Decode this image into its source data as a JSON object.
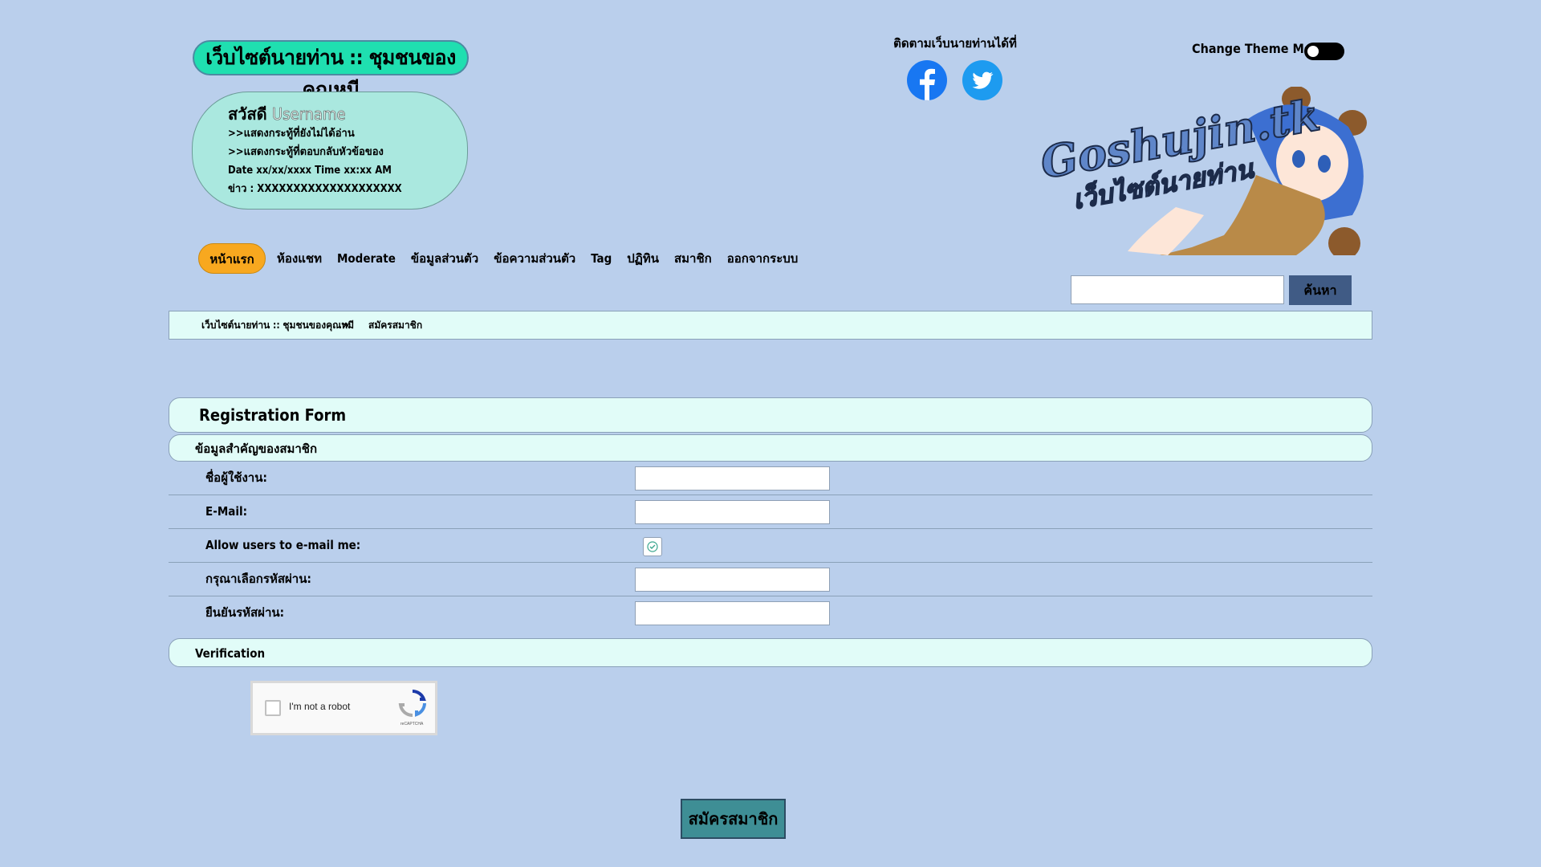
{
  "header": {
    "site_title": "เว็บไซต์นายท่าน :: ชุมชนของคุณหมี",
    "follow_label": "ติดตามเว็บนายท่านได้ที่",
    "theme_label": "Change Theme Mode",
    "logo_text": "Goshujin.tk",
    "logo_subtext": "เว็บไซต์นายท่าน",
    "social_icons": [
      "facebook-icon",
      "twitter-icon"
    ]
  },
  "user_panel": {
    "greeting": "สวัสดี",
    "username": "Username",
    "line1": ">>แสดงกระทู้ที่ยังไม่ได้อ่าน",
    "line2": ">>แสดงกระทู้ที่ตอบกลับหัวข้อของ",
    "line3": "Date xx/xx/xxxx Time xx:xx AM",
    "line4": "ข่าว : XXXXXXXXXXXXXXXXXXXX"
  },
  "nav": {
    "items": [
      "หน้าแรก",
      "ห้องแชท",
      "Moderate",
      "ข้อมูลส่วนตัว",
      "ข้อความส่วนตัว",
      "Tag",
      "ปฏิทิน",
      "สมาชิก",
      "ออกจากระบบ"
    ]
  },
  "search": {
    "button_label": "ค้นหา",
    "placeholder": ""
  },
  "breadcrumb": {
    "home": "เว็บไซต์นายท่าน :: ชุมชนของคุณหมี",
    "separator": "»",
    "current": "สมัครสมาชิก"
  },
  "form": {
    "title": "Registration Form",
    "member_section": "ข้อมูลสำคัญของสมาชิก",
    "fields": {
      "username": "ชื่อผู้ใช้งาน:",
      "email": "E-Mail:",
      "allow_email": "Allow users to e-mail me:",
      "password": "กรุณาเลือกรหัสผ่าน:",
      "confirm_password": "ยืนยันรหัสผ่าน:"
    },
    "allow_email_checked": true,
    "verification_section": "Verification",
    "recaptcha_text": "I'm not a robot",
    "recaptcha_brand": "reCAPTCHA",
    "submit_label": "สมัครสมาชิก"
  },
  "colors": {
    "background": "#bacfec",
    "title_pill": "#1fdfb0",
    "user_panel": "#aae8df",
    "nav_active": "#f8a81f",
    "section_bar": "#e1fcf8",
    "search_button": "#405b85",
    "submit_button": "#3e8e95"
  }
}
